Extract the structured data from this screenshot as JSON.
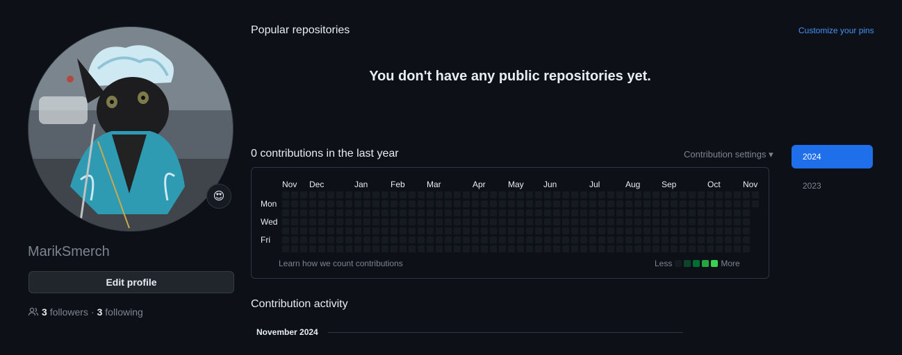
{
  "profile": {
    "username": "MarikSmerch",
    "edit_profile_label": "Edit profile",
    "followers_count": "3",
    "followers_label": "followers",
    "separator": "·",
    "following_count": "3",
    "following_label": "following",
    "status_emoji": "😍"
  },
  "popular": {
    "title": "Popular repositories",
    "customize_pins": "Customize your pins",
    "empty_message": "You don't have any public repositories yet."
  },
  "contributions": {
    "title": "0 contributions in the last year",
    "settings_label": "Contribution settings",
    "settings_caret": "▾",
    "months": [
      "Nov",
      "Dec",
      "Jan",
      "Feb",
      "Mar",
      "Apr",
      "May",
      "Jun",
      "Jul",
      "Aug",
      "Sep",
      "Oct",
      "Nov"
    ],
    "days": [
      "Mon",
      "Wed",
      "Fri"
    ],
    "learn_link": "Learn how we count contributions",
    "legend_less": "Less",
    "legend_more": "More",
    "legend_colors": [
      "#161b22",
      "#0e4429",
      "#006d32",
      "#26a641",
      "#39d353"
    ],
    "total_weeks": 53,
    "last_week_days": 2
  },
  "years": {
    "active": "2024",
    "inactive": "2023"
  },
  "activity": {
    "title": "Contribution activity",
    "month_label": "November 2024"
  },
  "colors": {
    "accent": "#1f6feb",
    "link": "#4493f8",
    "bg": "#0d1117"
  }
}
